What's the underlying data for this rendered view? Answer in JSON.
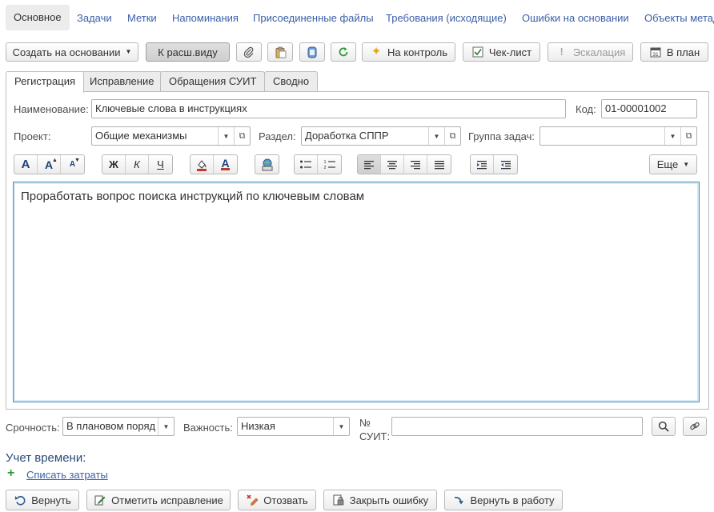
{
  "nav": {
    "items": [
      "Основное",
      "Задачи",
      "Метки",
      "Напоминания",
      "Присоединенные файлы",
      "Требования (исходящие)",
      "Ошибки на основании",
      "Объекты метад"
    ],
    "active": "Основное"
  },
  "toolbar": {
    "create_based": "Создать на основании",
    "ext_view": "К расш.виду",
    "control": "На контроль",
    "checklist": "Чек-лист",
    "escalation": "Эскалация",
    "plan": "В план"
  },
  "tabs": [
    "Регистрация",
    "Исправление",
    "Обращения СУИТ",
    "Сводно"
  ],
  "form": {
    "name_label": "Наименование:",
    "name_value": "Ключевые слова в инструкциях",
    "code_label": "Код:",
    "code_value": "01-00001002",
    "project_label": "Проект:",
    "project_value": "Общие механизмы",
    "section_label": "Раздел:",
    "section_value": "Доработка СППР",
    "group_label": "Группа задач:",
    "group_value": ""
  },
  "format_toolbar": {
    "bold": "Ж",
    "italic": "К",
    "underline": "Ч",
    "more": "Еще"
  },
  "editor": {
    "text": "Проработать вопрос поиска инструкций по ключевым словам"
  },
  "bottom": {
    "urgency_label": "Срочность:",
    "urgency_value": "В плановом поряд",
    "importance_label": "Важность:",
    "importance_value": "Низкая",
    "suit_label_1": "№",
    "suit_label_2": "СУИТ:",
    "suit_value": ""
  },
  "time": {
    "title": "Учет времени:",
    "write_off": "Списать затраты"
  },
  "actions": {
    "return": "Вернуть",
    "mark_fix": "Отметить исправление",
    "recall": "Отозвать",
    "close_bug": "Закрыть ошибку",
    "back_to_work": "Вернуть в работу"
  },
  "colors": {
    "link": "#3a5fa8",
    "editor_border": "#4a90b8",
    "section_title": "#2b4a7a"
  }
}
